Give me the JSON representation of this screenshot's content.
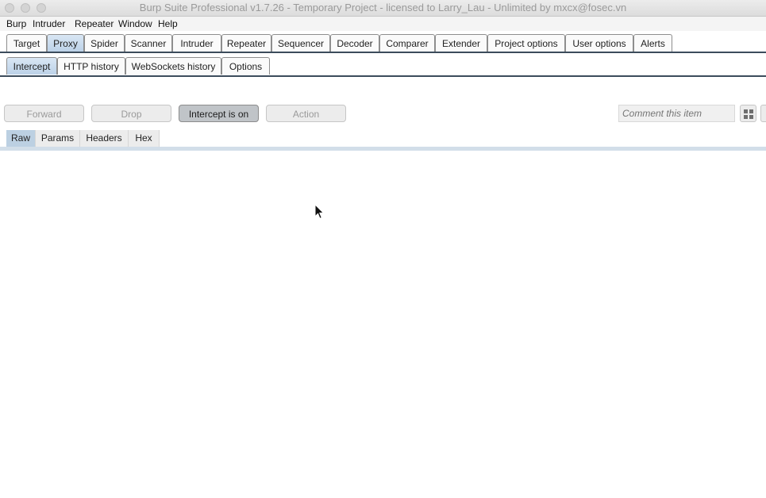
{
  "window": {
    "title": "Burp Suite Professional v1.7.26 - Temporary Project - licensed to Larry_Lau - Unlimited by mxcx@fosec.vn"
  },
  "menubar": [
    "Burp",
    "Intruder",
    "Repeater",
    "Window",
    "Help"
  ],
  "main_tabs": [
    "Target",
    "Proxy",
    "Spider",
    "Scanner",
    "Intruder",
    "Repeater",
    "Sequencer",
    "Decoder",
    "Comparer",
    "Extender",
    "Project options",
    "User options",
    "Alerts"
  ],
  "main_tabs_active": "Proxy",
  "proxy_tabs": [
    "Intercept",
    "HTTP history",
    "WebSockets history",
    "Options"
  ],
  "proxy_tabs_active": "Intercept",
  "intercept_toolbar": {
    "forward": "Forward",
    "drop": "Drop",
    "intercept_toggle": "Intercept is on",
    "action": "Action",
    "comment_placeholder": "Comment this item"
  },
  "message_tabs": [
    "Raw",
    "Params",
    "Headers",
    "Hex"
  ],
  "message_tabs_active": "Raw",
  "icons": {
    "layout": "grid-icon",
    "cursor": "mouse-pointer-icon"
  },
  "colors": {
    "active_tab": "#bcd2e8",
    "divider": "#3c4c5c",
    "toggle_on": "#c0c4c8"
  }
}
